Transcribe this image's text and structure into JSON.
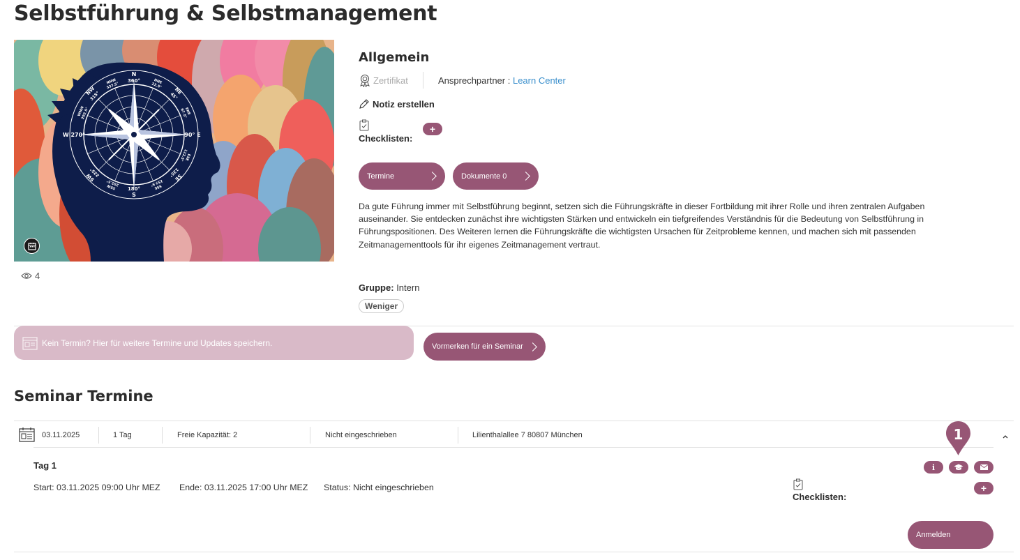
{
  "page": {
    "title": "Selbstführung & Selbstmanagement"
  },
  "course": {
    "views": "4",
    "section_heading": "Allgemein",
    "zertifikat": "Zertifikat",
    "ansprech_label": "Ansprechpartner :",
    "ansprech_link": "Learn Center",
    "notiz": "Notiz erstellen",
    "checklisten": "Checklisten:",
    "plus": "+",
    "termine_btn": "Termine",
    "dokumente_btn": "Dokumente 0",
    "description": "Da gute Führung immer mit Selbstführung beginnt, setzen sich die Führungskräfte in dieser Fortbildung mit ihrer Rolle und ihren zentralen Aufgaben auseinander. Sie entdecken zunächst ihre wichtigsten Stärken und entwickeln ein tiefgreifendes Verständnis für die Bedeutung von Selbstführung in Führungspositionen. Des Weiteren lernen die Führungskräfte die wichtigsten Ursachen für Zeitprobleme kennen, und machen sich mit passenden Zeitmanagementtools für ihr eigenes Zeitmanagement vertraut.",
    "gruppe_label": "Gruppe:",
    "gruppe_value": "Intern",
    "weniger": "Weniger"
  },
  "hero_image": {
    "compass_labels": {
      "n": "N",
      "deg360": "360°",
      "e": "90° E",
      "w": "W 270°",
      "deg180": "180°",
      "s": "S",
      "nw": "NW",
      "nw_deg": "315°",
      "ne": "NE",
      "ne_deg": "45°",
      "nnw": "NNW",
      "nnw_deg": "337.5°",
      "nne": "NNE",
      "nne_deg": "22.5°",
      "wnw": "WNW",
      "wnw_deg": "292.5°",
      "ene": "ENE",
      "ene_deg": "67.5°",
      "sw": "SW",
      "sw_deg": "225°",
      "se": "SE",
      "se_deg": "135°",
      "ssw": "SSW",
      "ssw_deg": "202.5°",
      "sse": "SSE",
      "sse_deg": "157.5°",
      "ese": "ESE",
      "ese_deg": "112.5°"
    }
  },
  "vormerken": {
    "banner_text": "Kein Termin? Hier für weitere Termine und Updates speichern.",
    "button": "Vormerken für ein Seminar"
  },
  "seminar": {
    "heading": "Seminar Termine",
    "row": {
      "date": "03.11.2025",
      "duration": "1 Tag",
      "capacity": "Freie Kapazität: 2",
      "status": "Nicht eingeschrieben",
      "location": "Lilienthalallee 7 80807 München"
    },
    "day": {
      "title": "Tag 1",
      "start": "Start: 03.11.2025 09:00 Uhr MEZ",
      "end": "Ende: 03.11.2025 17:00 Uhr MEZ",
      "status": "Status: Nicht eingeschrieben",
      "checklisten": "Checklisten:",
      "plus": "+"
    },
    "marker_number": "1",
    "anmelden": "Anmelden"
  },
  "colors": {
    "accent": "#975675",
    "banner": "#d9bac8",
    "link": "#3a8fcc",
    "navy": "#0e1d4a"
  }
}
